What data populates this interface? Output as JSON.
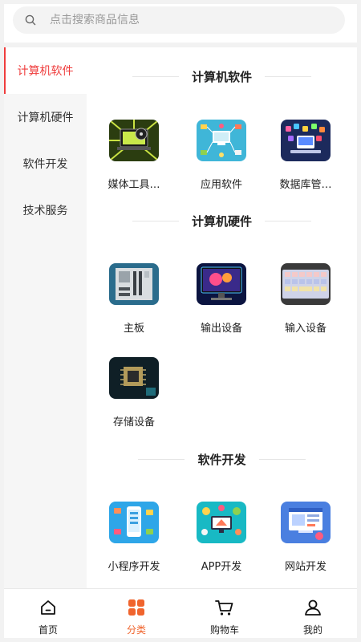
{
  "search": {
    "placeholder": "点击搜索商品信息"
  },
  "sidebar": {
    "items": [
      {
        "label": "计算机软件"
      },
      {
        "label": "计算机硬件"
      },
      {
        "label": "软件开发"
      },
      {
        "label": "技术服务"
      }
    ]
  },
  "sections": [
    {
      "title": "计算机软件",
      "items": [
        {
          "label": "媒体工具…",
          "icon": "media-tools-icon"
        },
        {
          "label": "应用软件",
          "icon": "app-software-icon"
        },
        {
          "label": "数据库管…",
          "icon": "database-icon"
        }
      ]
    },
    {
      "title": "计算机硬件",
      "items": [
        {
          "label": "主板",
          "icon": "motherboard-icon"
        },
        {
          "label": "输出设备",
          "icon": "monitor-icon"
        },
        {
          "label": "输入设备",
          "icon": "keyboard-icon"
        },
        {
          "label": "存储设备",
          "icon": "chip-icon"
        }
      ]
    },
    {
      "title": "软件开发",
      "items": [
        {
          "label": "小程序开发",
          "icon": "mini-program-icon"
        },
        {
          "label": "APP开发",
          "icon": "app-dev-icon"
        },
        {
          "label": "网站开发",
          "icon": "website-dev-icon"
        }
      ]
    }
  ],
  "tabbar": {
    "items": [
      {
        "label": "首页",
        "icon": "home-icon"
      },
      {
        "label": "分类",
        "icon": "category-icon"
      },
      {
        "label": "购物车",
        "icon": "cart-icon"
      },
      {
        "label": "我的",
        "icon": "profile-icon"
      }
    ]
  },
  "colors": {
    "accent": "#ef3d3d",
    "tab_active": "#f0642d",
    "sidebar_bg": "#f6f6f6"
  }
}
